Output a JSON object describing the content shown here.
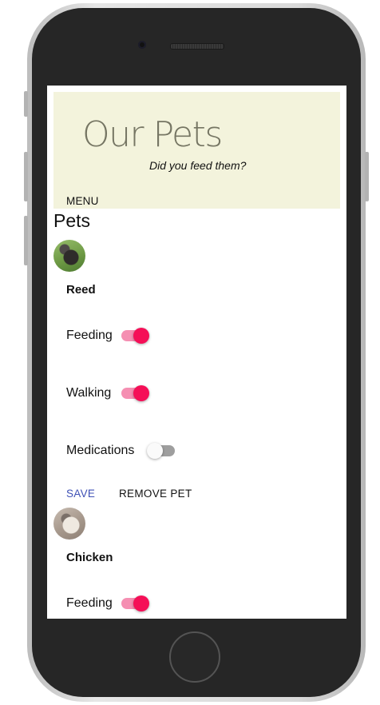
{
  "app": {
    "title": "Our Pets",
    "subtitle": "Did you feed them?",
    "menu_label": "MENU"
  },
  "section": {
    "title": "Pets"
  },
  "colors": {
    "header_bg": "#f3f3dc",
    "toggle_on": "#f50f57",
    "toggle_on_track": "#f58fb2",
    "toggle_off_track": "#9e9e9e",
    "save_accent": "#3f51b5"
  },
  "pets": [
    {
      "name": "Reed",
      "avatar": "dog-photo",
      "feeding_label": "Feeding",
      "feeding_on": true,
      "walking_label": "Walking",
      "walking_on": true,
      "medications_label": "Medications",
      "medications_on": false,
      "save_label": "SAVE",
      "remove_label": "REMOVE PET"
    },
    {
      "name": "Chicken",
      "avatar": "cat-photo",
      "feeding_label": "Feeding",
      "feeding_on": true
    }
  ]
}
